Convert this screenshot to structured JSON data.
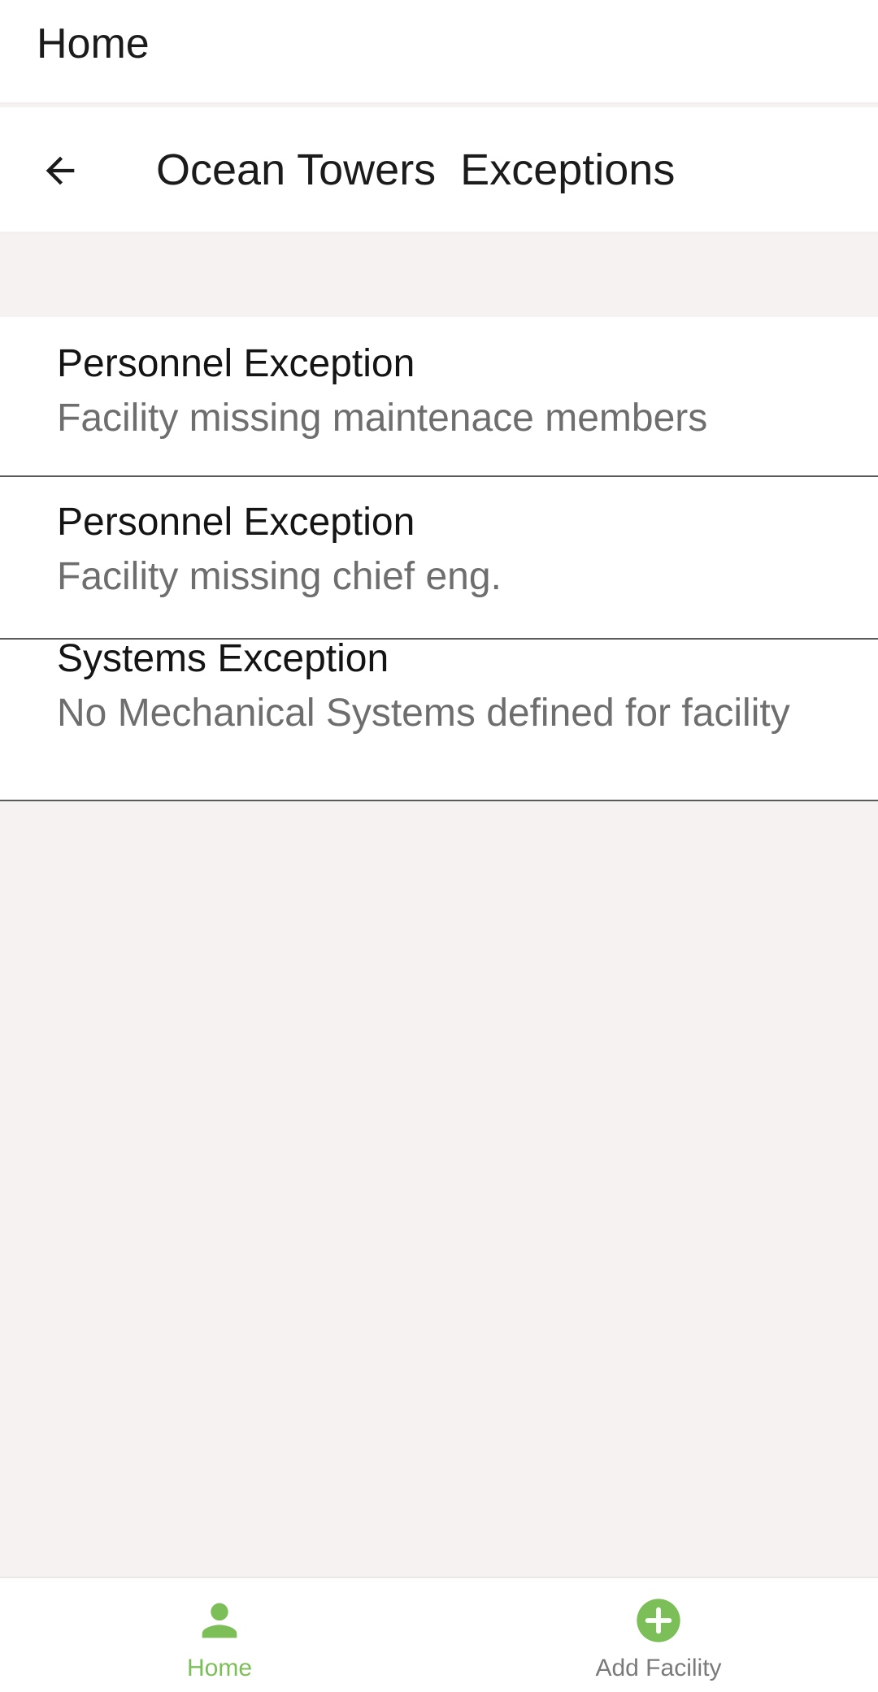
{
  "app_bar": {
    "title": "Home"
  },
  "sub_header": {
    "title": "Ocean Towers  Exceptions"
  },
  "exceptions": [
    {
      "title": "Personnel Exception",
      "description": "Facility missing maintenace members"
    },
    {
      "title": "Personnel Exception",
      "description": "Facility missing chief eng."
    },
    {
      "title": "Systems Exception",
      "description": "No Mechanical Systems defined for facility"
    }
  ],
  "bottom_nav": {
    "items": [
      {
        "label": "Home",
        "icon": "person-icon",
        "active": true
      },
      {
        "label": "Add Facility",
        "icon": "add-circle-icon",
        "active": false
      }
    ]
  },
  "colors": {
    "accent": "#7cbf58",
    "background": "#f5f2f1",
    "surface": "#ffffff",
    "text_primary": "#141414",
    "text_secondary": "#6e6e6e",
    "divider": "#5a5a5a"
  }
}
